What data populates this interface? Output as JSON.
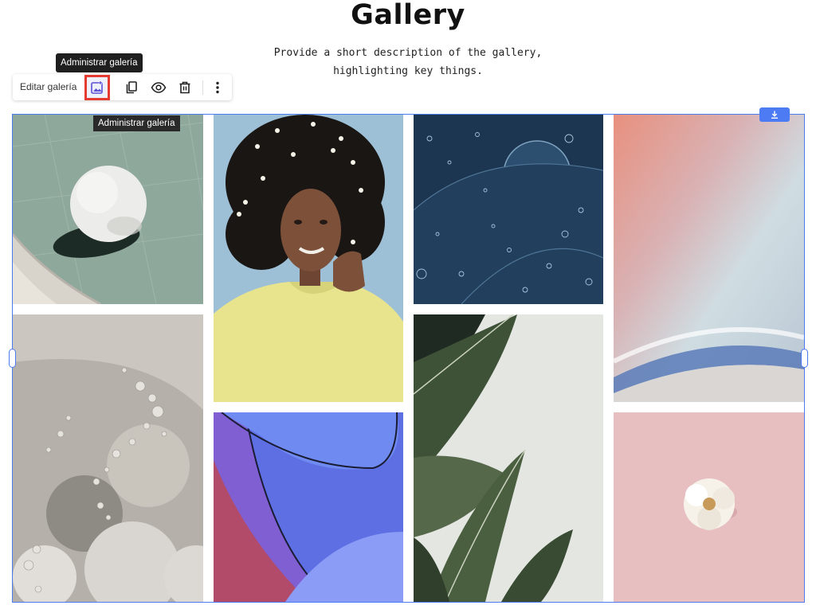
{
  "page": {
    "title": "Gallery",
    "subtitle_line1": "Provide a short description of the gallery,",
    "subtitle_line2": "highlighting key things."
  },
  "toolbar": {
    "edit_label": "Editar galería",
    "tooltip": "Administrar galería",
    "buttons": [
      {
        "name": "manage-gallery",
        "icon": "image-plus-icon",
        "active": true
      },
      {
        "name": "duplicate",
        "icon": "copy-icon"
      },
      {
        "name": "preview",
        "icon": "eye-icon"
      },
      {
        "name": "delete",
        "icon": "trash-icon"
      },
      {
        "name": "more",
        "icon": "more-vertical-icon"
      }
    ]
  },
  "gallery": {
    "tooltip": "Administrar galería",
    "download_icon": "download-icon",
    "accent": "#4d7bf3",
    "highlight": "#e53a2f",
    "images": [
      {
        "name": "white-sphere-photo"
      },
      {
        "name": "woman-portrait-photo"
      },
      {
        "name": "water-bubbles-photo"
      },
      {
        "name": "gradient-abstract-photo"
      },
      {
        "name": "grey-circles-photo"
      },
      {
        "name": "blue-curves-photo"
      },
      {
        "name": "banana-leaf-photo"
      },
      {
        "name": "white-flower-photo"
      }
    ]
  }
}
